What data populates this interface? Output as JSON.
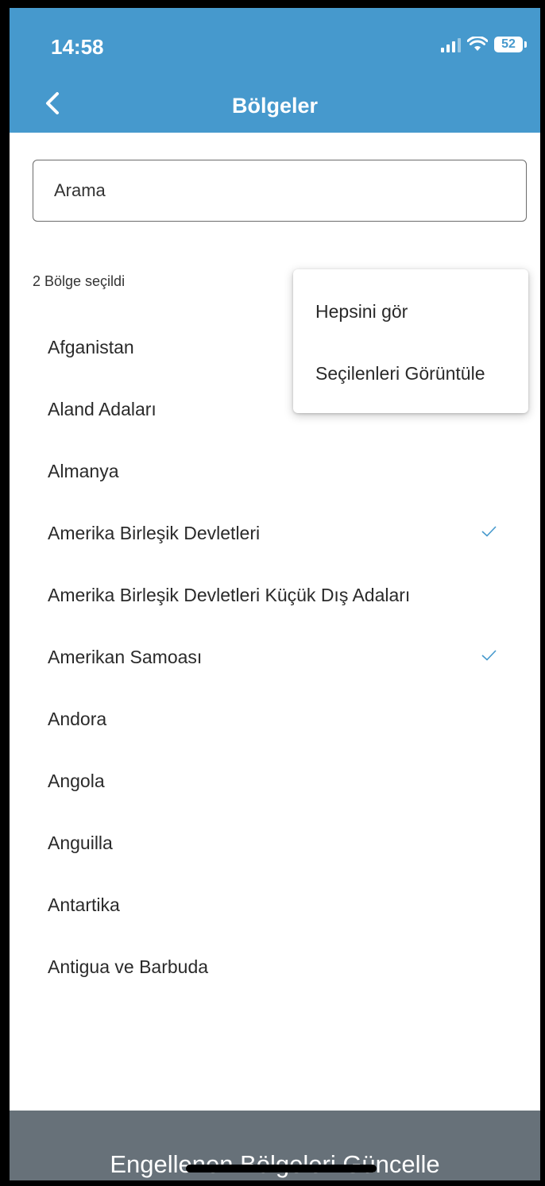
{
  "status_bar": {
    "time": "14:58",
    "battery": "52"
  },
  "header": {
    "title": "Bölgeler"
  },
  "search": {
    "placeholder": "Arama"
  },
  "selection": {
    "count_text": "2 Bölge seçildi"
  },
  "menu": {
    "items": [
      "Hepsini gör",
      "Seçilenleri Görüntüle"
    ]
  },
  "regions": [
    {
      "name": "Afganistan",
      "selected": false
    },
    {
      "name": "Aland Adaları",
      "selected": false
    },
    {
      "name": "Almanya",
      "selected": false
    },
    {
      "name": "Amerika Birleşik Devletleri",
      "selected": true
    },
    {
      "name": "Amerika Birleşik Devletleri Küçük Dış Adaları",
      "selected": false
    },
    {
      "name": "Amerikan Samoası",
      "selected": true
    },
    {
      "name": "Andora",
      "selected": false
    },
    {
      "name": "Angola",
      "selected": false
    },
    {
      "name": "Anguilla",
      "selected": false
    },
    {
      "name": "Antartika",
      "selected": false
    },
    {
      "name": "Antigua ve Barbuda",
      "selected": false
    }
  ],
  "footer": {
    "button_label": "Engellenen Bölgeleri Güncelle"
  },
  "colors": {
    "header_bg": "#4699cd",
    "button_bg": "#677179",
    "check": "#4699cd"
  },
  "icons": {
    "back": "chevron-left-icon",
    "check": "checkmark-icon",
    "signal": "signal-icon",
    "wifi": "wifi-icon",
    "battery": "battery-icon"
  }
}
